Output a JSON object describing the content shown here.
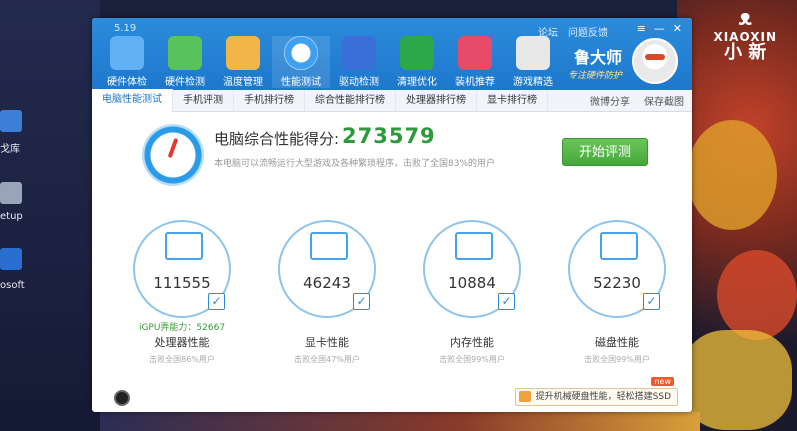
{
  "brand": {
    "cat": "ᴥ",
    "line1": "XIAOXIN",
    "line2": "小  新"
  },
  "desktop": {
    "icons": [
      {
        "label": "戈库",
        "color": "#3b7fd8"
      },
      {
        "label": "etup",
        "color": "#9aa4b8"
      },
      {
        "label": "osoft",
        "color": "#2a6ed0"
      }
    ]
  },
  "window": {
    "version": "5.19",
    "toolbar": [
      {
        "label": "硬件体检",
        "color": "#5fb0f5"
      },
      {
        "label": "硬件检测",
        "color": "#59c35b"
      },
      {
        "label": "温度管理",
        "color": "#f2b648"
      },
      {
        "label": "性能测试",
        "color": "#3da0f0"
      },
      {
        "label": "驱动检测",
        "color": "#3a6fd8"
      },
      {
        "label": "清理优化",
        "color": "#2aa84a"
      },
      {
        "label": "装机推荐",
        "color": "#e84a6a"
      },
      {
        "label": "游戏精选",
        "color": "#e8e8e8"
      }
    ],
    "topmenu": [
      "论坛",
      "问题反馈"
    ],
    "controls": [
      "≡",
      "—",
      "✕"
    ],
    "brand_name": "鲁大师",
    "brand_slogan": "专注硬件防护",
    "tabs": [
      "电脑性能测试",
      "手机评测",
      "手机排行榜",
      "综合性能排行榜",
      "处理器排行榜",
      "显卡排行榜"
    ],
    "tab_right": [
      "微博分享",
      "保存截图"
    ]
  },
  "score": {
    "label": "电脑综合性能得分:",
    "value": "273579",
    "description": "本电脑可以流畅运行大型游戏及各种繁琐程序，击败了全国83%的用户",
    "start_button": "开始评测"
  },
  "cards": [
    {
      "value": "111555",
      "title": "处理器性能",
      "sub": "击败全国86%用户",
      "igpu": "iGPU弄能力：52667",
      "checked": "✓"
    },
    {
      "value": "46243",
      "title": "显卡性能",
      "sub": "击败全国47%用户",
      "igpu": "",
      "checked": "✓"
    },
    {
      "value": "10884",
      "title": "内存性能",
      "sub": "击败全国99%用户",
      "igpu": "",
      "checked": "✓"
    },
    {
      "value": "52230",
      "title": "磁盘性能",
      "sub": "击败全国99%用户",
      "igpu": "",
      "checked": "✓"
    }
  ],
  "ad": {
    "text": "提升机械硬盘性能，轻松搭建SSD",
    "badge": "new"
  },
  "colors": {
    "titlebar": "#1d78cc",
    "score": "#2c9a3a",
    "start": "#45a83a"
  }
}
